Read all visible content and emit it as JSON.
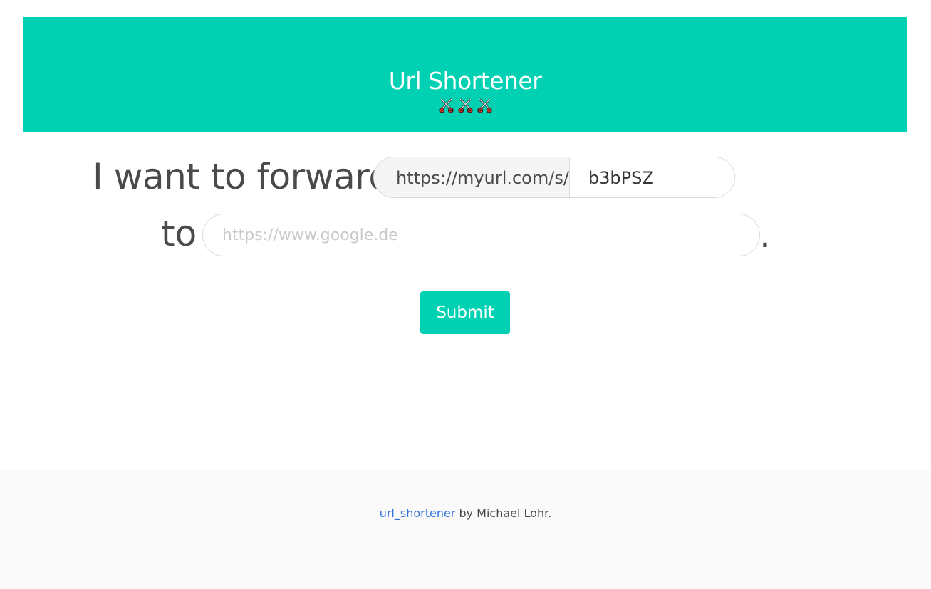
{
  "header": {
    "title": "Url Shortener",
    "icons": [
      "scissors-icon",
      "scissors-icon",
      "scissors-icon"
    ],
    "background_color": "#00d1b2"
  },
  "form": {
    "line1_text": "I want to forward",
    "url_prefix": "https://myurl.com/s/",
    "short_code_value": "b3bPSZ",
    "line2_text": "to",
    "target_placeholder": "https://www.google.de",
    "target_value": "",
    "period": ".",
    "submit_label": "Submit"
  },
  "footer": {
    "link_text": "url_shortener",
    "byline": " by Michael Lohr.",
    "link_color": "#3273dc"
  }
}
